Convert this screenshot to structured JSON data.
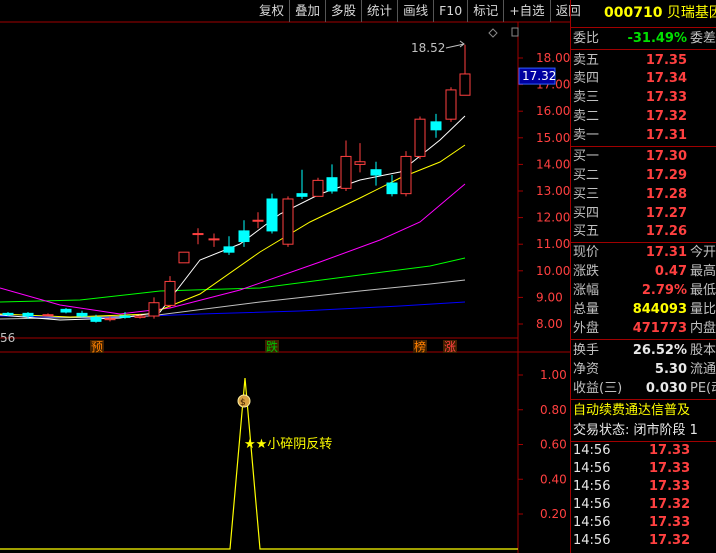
{
  "toolbar": {
    "buttons": [
      "复权",
      "叠加",
      "多股",
      "统计",
      "画线",
      "F10",
      "标记",
      "+自选",
      "返回"
    ]
  },
  "stock": {
    "code": "000710",
    "name": "贝瑞基因"
  },
  "price_chart": {
    "current_price_tag": "17.32",
    "peak_label": "18.52",
    "y_axis": [
      "18.00",
      "17.00",
      "16.00",
      "15.00",
      "14.00",
      "13.00",
      "12.00",
      "11.00",
      "10.00",
      "9.00",
      "8.00"
    ],
    "left_label": "56",
    "markers": [
      "预",
      "跌",
      "榜",
      "涨"
    ]
  },
  "indicator_chart": {
    "y_axis": [
      "1.00",
      "0.80",
      "0.60",
      "0.40",
      "0.20"
    ],
    "signal_label": "★★小碎阴反转",
    "signal_icon": "money-bag-icon"
  },
  "orderbook": {
    "weibi": {
      "label": "委比",
      "value": "-31.49%",
      "extra": "委差"
    },
    "sell": [
      {
        "label": "卖五",
        "price": "17.35"
      },
      {
        "label": "卖四",
        "price": "17.34"
      },
      {
        "label": "卖三",
        "price": "17.33"
      },
      {
        "label": "卖二",
        "price": "17.32"
      },
      {
        "label": "卖一",
        "price": "17.31"
      }
    ],
    "buy": [
      {
        "label": "买一",
        "price": "17.30"
      },
      {
        "label": "买二",
        "price": "17.29"
      },
      {
        "label": "买三",
        "price": "17.28"
      },
      {
        "label": "买四",
        "price": "17.27"
      },
      {
        "label": "买五",
        "price": "17.26"
      }
    ]
  },
  "quote": [
    {
      "label": "现价",
      "value": "17.31",
      "extra": "今开",
      "color": "red"
    },
    {
      "label": "涨跌",
      "value": "0.47",
      "extra": "最高",
      "color": "red"
    },
    {
      "label": "涨幅",
      "value": "2.79%",
      "extra": "最低",
      "color": "red"
    },
    {
      "label": "总量",
      "value": "844093",
      "extra": "量比",
      "color": "yellow"
    },
    {
      "label": "外盘",
      "value": "471773",
      "extra": "内盘",
      "color": "red"
    }
  ],
  "finance": [
    {
      "label": "换手",
      "value": "26.52%",
      "extra": "股本"
    },
    {
      "label": "净资",
      "value": "5.30",
      "extra": "流通"
    },
    {
      "label": "收益(三)",
      "value": "0.030",
      "extra": "PE(动"
    }
  ],
  "news_ticker": "自动续费通达信普及",
  "trade_status": "交易状态: 闭市阶段 1",
  "ticks": [
    {
      "time": "14:56",
      "price": "17.33"
    },
    {
      "time": "14:56",
      "price": "17.33"
    },
    {
      "time": "14:56",
      "price": "17.33"
    },
    {
      "time": "14:56",
      "price": "17.32"
    },
    {
      "time": "14:56",
      "price": "17.33"
    },
    {
      "time": "14:56",
      "price": "17.32"
    }
  ],
  "colors": {
    "up": "#ff4040",
    "down": "#00ffff",
    "ma5": "#ffffff",
    "ma10": "#ffff00",
    "ma20": "#ff00ff",
    "ma60": "#00ff00",
    "ma120": "#c0c0c0",
    "ma250": "#0000ff",
    "grid": "#a00000"
  }
}
